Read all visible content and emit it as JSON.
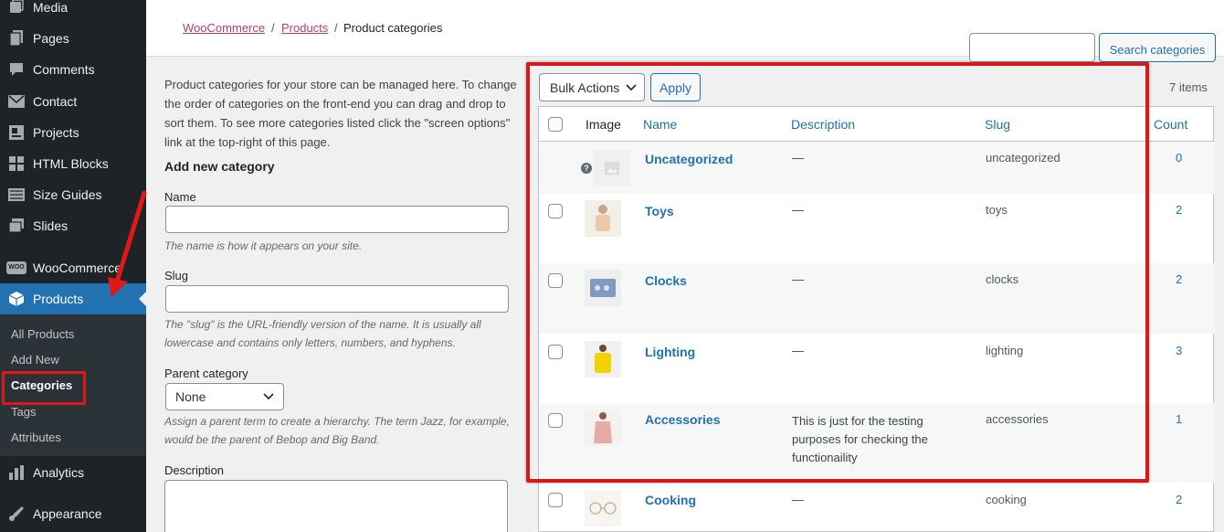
{
  "sidebar": {
    "items": [
      {
        "label": "Media",
        "icon": "media-icon"
      },
      {
        "label": "Pages",
        "icon": "pages-icon"
      },
      {
        "label": "Comments",
        "icon": "comments-icon"
      },
      {
        "label": "Contact",
        "icon": "contact-icon"
      },
      {
        "label": "Projects",
        "icon": "projects-icon"
      },
      {
        "label": "HTML Blocks",
        "icon": "html-blocks-icon"
      },
      {
        "label": "Size Guides",
        "icon": "size-guides-icon"
      },
      {
        "label": "Slides",
        "icon": "slides-icon"
      },
      {
        "label": "WooCommerce",
        "icon": "woocommerce-icon"
      },
      {
        "label": "Products",
        "icon": "products-icon"
      },
      {
        "label": "Analytics",
        "icon": "analytics-icon"
      },
      {
        "label": "Appearance",
        "icon": "appearance-icon"
      }
    ],
    "woo_badge": "WOO",
    "submenu": [
      "All Products",
      "Add New",
      "Categories",
      "Tags",
      "Attributes"
    ]
  },
  "breadcrumb": {
    "woocommerce": "WooCommerce",
    "products": "Products",
    "sep": "/",
    "current": "Product categories"
  },
  "form": {
    "intro": "Product categories for your store can be managed here. To change the order of categories on the front-end you can drag and drop to sort them. To see more categories listed click the \"screen options\" link at the top-right of this page.",
    "heading": "Add new category",
    "name_label": "Name",
    "name_help": "The name is how it appears on your site.",
    "slug_label": "Slug",
    "slug_help": "The \"slug\" is the URL-friendly version of the name. It is usually all lowercase and contains only letters, numbers, and hyphens.",
    "parent_label": "Parent category",
    "parent_value": "None",
    "parent_help": "Assign a parent term to create a hierarchy. The term Jazz, for example, would be the parent of Bebop and Big Band.",
    "description_label": "Description"
  },
  "search": {
    "button_label": "Search categories"
  },
  "toolbar": {
    "bulk_actions": "Bulk Actions",
    "apply": "Apply",
    "items_count": "7 items"
  },
  "table": {
    "headers": {
      "image": "Image",
      "name": "Name",
      "description": "Description",
      "slug": "Slug",
      "count": "Count"
    },
    "rows": [
      {
        "name": "Uncategorized",
        "description": "—",
        "slug": "uncategorized",
        "count": "0"
      },
      {
        "name": "Toys",
        "description": "—",
        "slug": "toys",
        "count": "2"
      },
      {
        "name": "Clocks",
        "description": "—",
        "slug": "clocks",
        "count": "2"
      },
      {
        "name": "Lighting",
        "description": "—",
        "slug": "lighting",
        "count": "3"
      },
      {
        "name": "Accessories",
        "description": "This is just for the testing purposes for checking the functionaility",
        "slug": "accessories",
        "count": "1"
      },
      {
        "name": "Cooking",
        "description": "—",
        "slug": "cooking",
        "count": "2"
      }
    ]
  },
  "colors": {
    "sidebar_bg": "#1d2327",
    "active": "#2271b1",
    "link": "#2271b1",
    "breadcrumb_link": "#b33f6e",
    "annotation_red": "#d61a1a"
  }
}
